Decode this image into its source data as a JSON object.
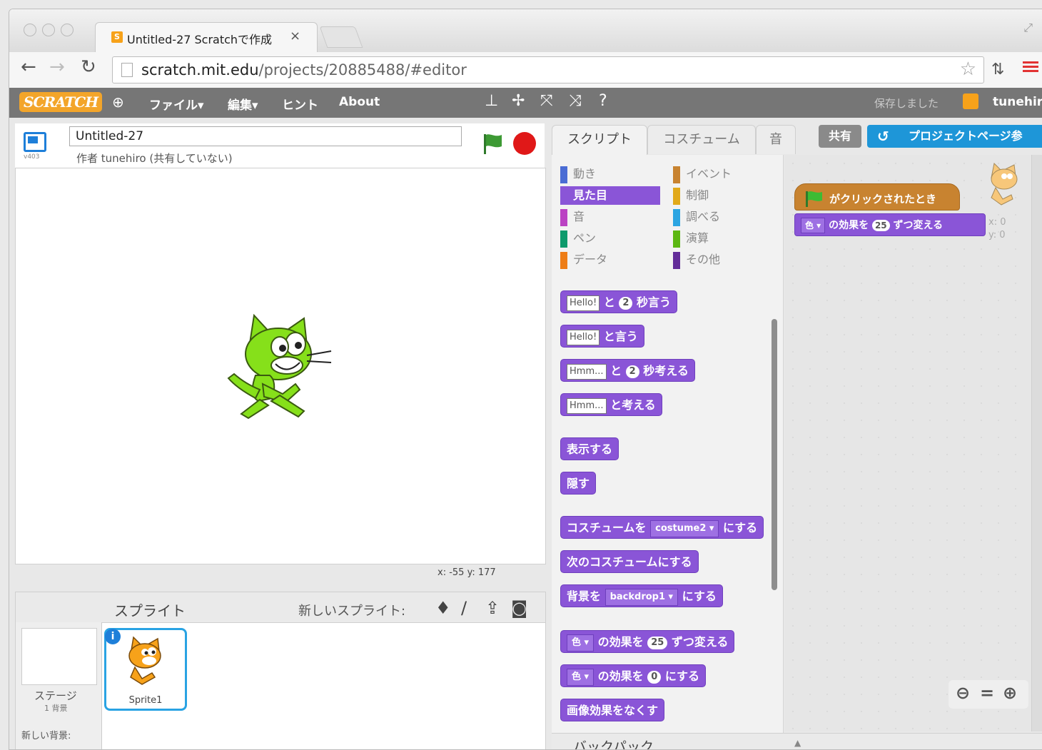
{
  "browser": {
    "tab_title": "Untitled-27 Scratchで作成",
    "tab_close": "×",
    "favicon_letter": "S",
    "url_host": "scratch.mit.edu",
    "url_path": "/projects/20885488/#editor"
  },
  "scratch_menu": {
    "logo": "SCRATCH",
    "items": [
      "ファイル▾",
      "編集▾",
      "ヒント",
      "About"
    ],
    "saved_status": "保存しました",
    "username": "tunehiro"
  },
  "project": {
    "title": "Untitled-27",
    "author_line": "作者 tunehiro (共有していない)",
    "version": "v403"
  },
  "stage": {
    "coords": "x: -55   y: 177"
  },
  "sprite_pane": {
    "title": "スプライト",
    "new_sprite_label": "新しいスプライト:",
    "stage_label": "ステージ",
    "stage_sub": "1 背景",
    "new_backdrop_label": "新しい背景:",
    "sprite_name": "Sprite1",
    "info_icon": "i"
  },
  "editor_tabs": [
    "スクリプト",
    "コスチューム",
    "音"
  ],
  "buttons": {
    "share": "共有",
    "project_page": "プロジェクトページ参"
  },
  "categories": {
    "left": [
      {
        "label": "動き",
        "color": "#4a6cd4"
      },
      {
        "label": "見た目",
        "color": "#8a55d7"
      },
      {
        "label": "音",
        "color": "#bb42c3"
      },
      {
        "label": "ペン",
        "color": "#0e9a6c"
      },
      {
        "label": "データ",
        "color": "#ee7d16"
      }
    ],
    "right": [
      {
        "label": "イベント",
        "color": "#c88330"
      },
      {
        "label": "制御",
        "color": "#e1a91a"
      },
      {
        "label": "調べる",
        "color": "#2ca5e2"
      },
      {
        "label": "演算",
        "color": "#5cb712"
      },
      {
        "label": "その他",
        "color": "#632d99"
      }
    ],
    "selected": "見た目"
  },
  "blocks": {
    "say_secs": {
      "input": "Hello!",
      "mid": "と",
      "num": "2",
      "end": "秒言う"
    },
    "say": {
      "input": "Hello!",
      "end": "と言う"
    },
    "think_secs": {
      "input": "Hmm...",
      "mid": "と",
      "num": "2",
      "end": "秒考える"
    },
    "think": {
      "input": "Hmm...",
      "end": "と考える"
    },
    "show": "表示する",
    "hide": "隠す",
    "switch_costume": {
      "start": "コスチュームを",
      "drop": "costume2 ▾",
      "end": "にする"
    },
    "next_costume": "次のコスチュームにする",
    "switch_backdrop": {
      "start": "背景を",
      "drop": "backdrop1 ▾",
      "end": "にする"
    },
    "change_effect": {
      "drop": "色 ▾",
      "mid": "の効果を",
      "num": "25",
      "end": "ずつ変える"
    },
    "set_effect": {
      "drop": "色 ▾",
      "mid": "の効果を",
      "num": "0",
      "end": "にする"
    },
    "clear_effects": "画像効果をなくす"
  },
  "script": {
    "hat_text": "がクリックされたとき",
    "effect": {
      "drop": "色 ▾",
      "mid": "の効果を",
      "num": "25",
      "end": "ずつ変える"
    },
    "sprite_x": "x: 0",
    "sprite_y": "y: 0"
  },
  "backpack": {
    "label": "バックパック",
    "arrow": "▲"
  },
  "colors": {
    "looks": "#8a55d7",
    "events": "#c88330",
    "sprite_green": "#86e01a",
    "accent_blue": "#1e96d8"
  }
}
